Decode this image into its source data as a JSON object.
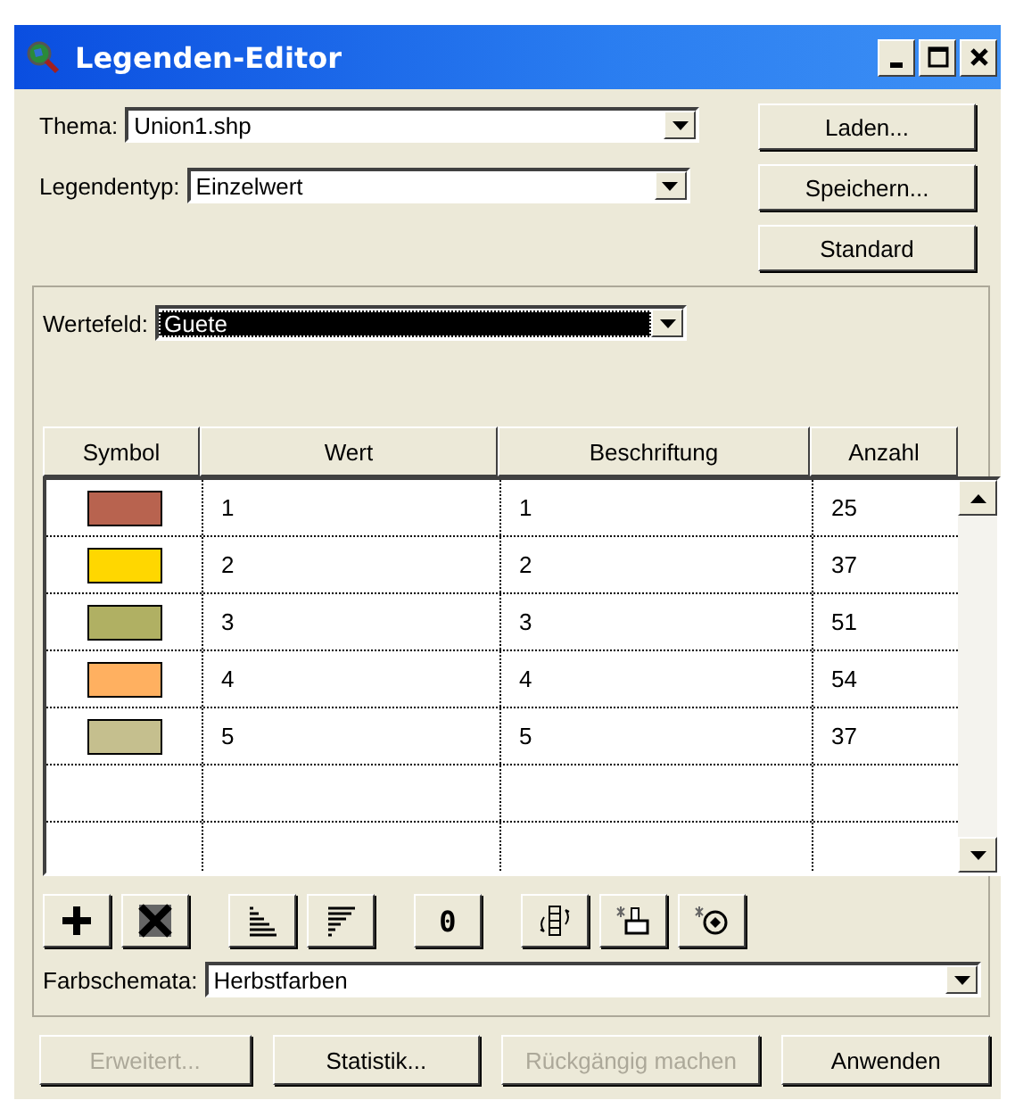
{
  "window": {
    "title": "Legenden-Editor"
  },
  "thema": {
    "label": "Thema:",
    "value": "Union1.shp"
  },
  "legendentyp": {
    "label": "Legendentyp:",
    "value": "Einzelwert"
  },
  "side_buttons": [
    "Laden...",
    "Speichern...",
    "Standard"
  ],
  "wertefeld": {
    "label": "Wertefeld:",
    "value": "Guete",
    "focused": true
  },
  "table": {
    "columns": [
      "Symbol",
      "Wert",
      "Beschriftung",
      "Anzahl"
    ],
    "rows": [
      {
        "color": "#b8634f",
        "wert": "1",
        "beschriftung": "1",
        "anzahl": "25"
      },
      {
        "color": "#ffd700",
        "wert": "2",
        "beschriftung": "2",
        "anzahl": "37"
      },
      {
        "color": "#b0b063",
        "wert": "3",
        "beschriftung": "3",
        "anzahl": "51"
      },
      {
        "color": "#ffb060",
        "wert": "4",
        "beschriftung": "4",
        "anzahl": "54"
      },
      {
        "color": "#c5bf8e",
        "wert": "5",
        "beschriftung": "5",
        "anzahl": "37"
      }
    ]
  },
  "toolbar": [
    {
      "kind": "add"
    },
    {
      "kind": "delete"
    },
    {
      "kind": "sort-asc"
    },
    {
      "kind": "sort-desc"
    },
    {
      "kind": "text",
      "text": "0"
    },
    {
      "kind": "flip"
    },
    {
      "kind": "brush"
    },
    {
      "kind": "reset"
    }
  ],
  "farbschemata": {
    "label": "Farbschemata:",
    "value": "Herbstfarben"
  },
  "bottom_buttons": [
    {
      "label": "Erweitert...",
      "disabled": true
    },
    {
      "label": "Statistik...",
      "disabled": false
    },
    {
      "label": "Rückgängig machen",
      "disabled": true
    },
    {
      "label": "Anwenden",
      "disabled": false
    }
  ]
}
